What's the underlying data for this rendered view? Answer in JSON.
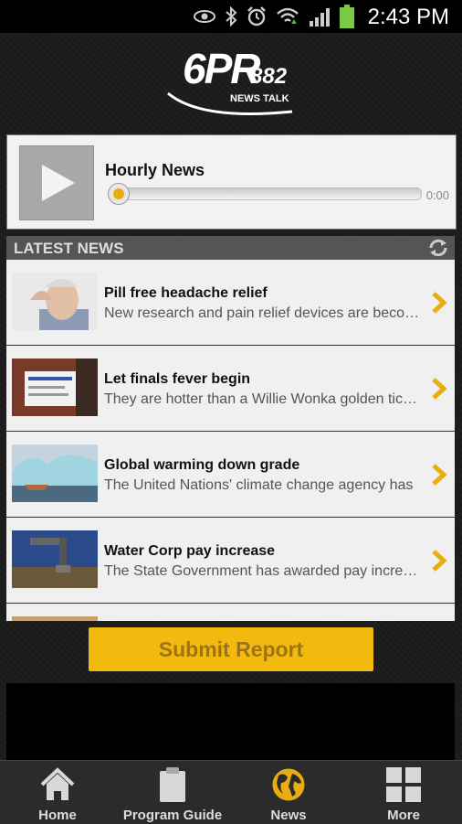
{
  "status_bar": {
    "time": "2:43 PM",
    "icons": [
      "eye-icon",
      "bluetooth-icon",
      "alarm-icon",
      "wifi-icon",
      "signal-icon",
      "battery-icon"
    ]
  },
  "logo": {
    "main": "6PR",
    "number": "882",
    "tagline": "NEWS TALK"
  },
  "player": {
    "title": "Hourly News",
    "duration": "0:00",
    "progress": 0
  },
  "latest_news": {
    "header": "LATEST NEWS",
    "items": [
      {
        "headline": "Pill free headache relief",
        "summary": "New research and pain relief devices are becoming available"
      },
      {
        "headline": "Let finals fever begin",
        "summary": "They are hotter than a Willie Wonka golden ticket"
      },
      {
        "headline": "Global warming down grade",
        "summary": "The United Nations' climate change agency has"
      },
      {
        "headline": "Water Corp pay increase",
        "summary": "The State Government has awarded pay increases"
      }
    ]
  },
  "submit_label": "Submit Report",
  "nav": {
    "home": "Home",
    "program_guide": "Program Guide",
    "news": "News",
    "more": "More"
  },
  "colors": {
    "accent": "#f2ba0f",
    "chevron": "#e9ad0f"
  }
}
